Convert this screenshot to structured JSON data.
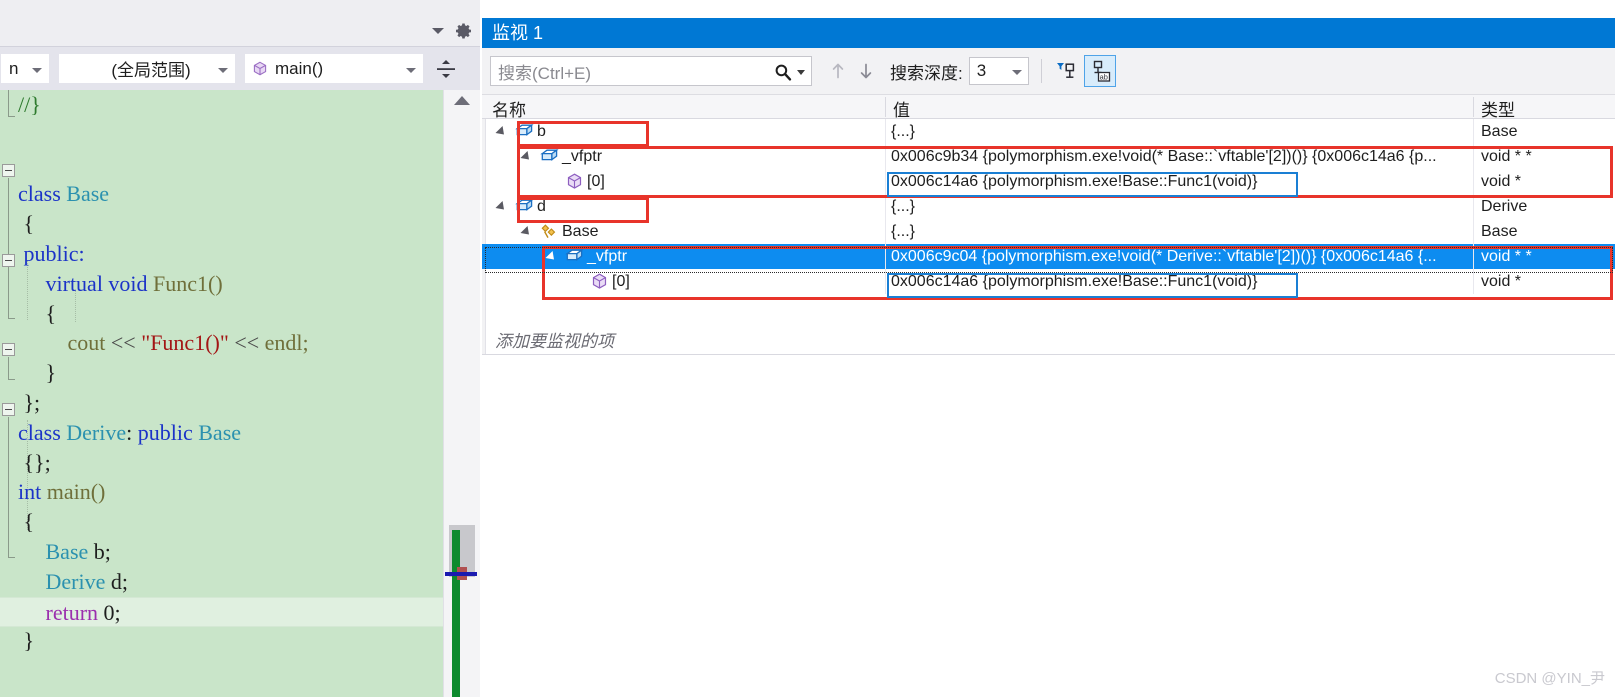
{
  "editor": {
    "toolbar": {
      "file_combo": "n",
      "scope_combo": "(全局范围)",
      "member_combo": "main()",
      "member_icon": "cube-icon",
      "split_view_icon": "split-window-icon",
      "chevron_icon": "chevron-down-icon",
      "gear_icon": "gear-icon"
    },
    "code_lines": [
      {
        "indent": 0,
        "tokens": [
          {
            "t": "//}",
            "c": "tok-cmt"
          }
        ]
      },
      {
        "indent": 0,
        "tokens": []
      },
      {
        "indent": 0,
        "tokens": []
      },
      {
        "indent": 0,
        "tokens": [
          {
            "t": "class ",
            "c": "tok-key"
          },
          {
            "t": "Base",
            "c": "tok-type"
          }
        ]
      },
      {
        "indent": 0,
        "tokens": [
          {
            "t": " {",
            "c": "tok-plain"
          }
        ]
      },
      {
        "indent": 0,
        "tokens": [
          {
            "t": " public:",
            "c": "tok-key"
          }
        ]
      },
      {
        "indent": 0,
        "tokens": [
          {
            "t": "     virtual void ",
            "c": "tok-key"
          },
          {
            "t": "Func1()",
            "c": "tok-fn"
          }
        ]
      },
      {
        "indent": 0,
        "tokens": [
          {
            "t": "     {",
            "c": "tok-plain"
          }
        ]
      },
      {
        "indent": 0,
        "tokens": [
          {
            "t": "         cout ",
            "c": "tok-fn"
          },
          {
            "t": "<< ",
            "c": "tok-op"
          },
          {
            "t": "\"Func1()\"",
            "c": "tok-str"
          },
          {
            "t": " << ",
            "c": "tok-op"
          },
          {
            "t": "endl;",
            "c": "tok-fn"
          }
        ]
      },
      {
        "indent": 0,
        "tokens": [
          {
            "t": "     }",
            "c": "tok-plain"
          }
        ]
      },
      {
        "indent": 0,
        "tokens": [
          {
            "t": " };",
            "c": "tok-plain"
          }
        ]
      },
      {
        "indent": 0,
        "tokens": [
          {
            "t": "class ",
            "c": "tok-key"
          },
          {
            "t": "Derive",
            "c": "tok-type"
          },
          {
            "t": ": ",
            "c": "tok-plain"
          },
          {
            "t": "public ",
            "c": "tok-key"
          },
          {
            "t": "Base",
            "c": "tok-type"
          }
        ]
      },
      {
        "indent": 0,
        "tokens": [
          {
            "t": " {};",
            "c": "tok-plain"
          }
        ]
      },
      {
        "indent": 0,
        "tokens": [
          {
            "t": "int ",
            "c": "tok-key"
          },
          {
            "t": "main()",
            "c": "tok-fn"
          }
        ]
      },
      {
        "indent": 0,
        "tokens": [
          {
            "t": " {",
            "c": "tok-plain"
          }
        ]
      },
      {
        "indent": 0,
        "tokens": [
          {
            "t": "     Base",
            "c": "tok-type"
          },
          {
            "t": " b;",
            "c": "tok-plain"
          }
        ]
      },
      {
        "indent": 0,
        "tokens": [
          {
            "t": "     Derive",
            "c": "tok-type"
          },
          {
            "t": " d;",
            "c": "tok-plain"
          }
        ]
      },
      {
        "indent": 0,
        "tokens": [
          {
            "t": "     return ",
            "c": "tok-pink"
          },
          {
            "t": "0;",
            "c": "tok-plain"
          }
        ],
        "current": true
      },
      {
        "indent": 0,
        "tokens": [
          {
            "t": " }",
            "c": "tok-plain"
          }
        ]
      }
    ],
    "scrollbar": {
      "up_arrow_icon": "scroll-up-arrow-icon"
    }
  },
  "watch": {
    "title": "监视 1",
    "toolbar": {
      "search_placeholder": "搜索(Ctrl+E)",
      "search_icon": "search-icon",
      "search_dropdown_icon": "chevron-down-icon",
      "prev_icon": "arrow-up-icon",
      "next_icon": "arrow-down-icon",
      "depth_label": "搜索深度:",
      "depth_value": "3",
      "pin_icon": "filter-pin-icon",
      "pin_ab_icon": "pin-ab-icon"
    },
    "columns": {
      "name": "名称",
      "value": "值",
      "type": "类型"
    },
    "rows": [
      {
        "depth": 0,
        "expanded": true,
        "icon": "field-box-icon",
        "name": "b",
        "value": "{...}",
        "type": "Base",
        "selected": false
      },
      {
        "depth": 1,
        "expanded": true,
        "icon": "field-box-icon",
        "name": "_vfptr",
        "value": "0x006c9b34 {polymorphism.exe!void(* Base::`vftable'[2])()} {0x006c14a6 {p...",
        "type": "void * *",
        "selected": false
      },
      {
        "depth": 2,
        "expanded": null,
        "icon": "cube-icon",
        "name": "[0]",
        "value": "0x006c14a6 {polymorphism.exe!Base::Func1(void)}",
        "type": "void *",
        "selected": false
      },
      {
        "depth": 0,
        "expanded": true,
        "icon": "field-box-icon",
        "name": "d",
        "value": "{...}",
        "type": "Derive",
        "selected": false
      },
      {
        "depth": 1,
        "expanded": true,
        "icon": "base-link-icon",
        "name": "Base",
        "value": "{...}",
        "type": "Base",
        "selected": false
      },
      {
        "depth": 2,
        "expanded": true,
        "icon": "field-box-icon",
        "name": "_vfptr",
        "value": "0x006c9c04 {polymorphism.exe!void(* Derive::`vftable'[2])()} {0x006c14a6 {...",
        "type": "void * *",
        "selected": true
      },
      {
        "depth": 3,
        "expanded": null,
        "icon": "cube-icon",
        "name": "[0]",
        "value": "0x006c14a6 {polymorphism.exe!Base::Func1(void)}",
        "type": "void *",
        "selected": false
      }
    ],
    "empty_row_prompt": "添加要监视的项"
  },
  "watermark": "CSDN @YIN_尹",
  "colors": {
    "title_bar": "#0078d4",
    "selection": "#0d8cf0",
    "annotation_red": "#e8342a",
    "annotation_blue": "#1a7fd4",
    "code_background": "#c9e5c9",
    "change_bar_green": "#0d8a2e"
  }
}
